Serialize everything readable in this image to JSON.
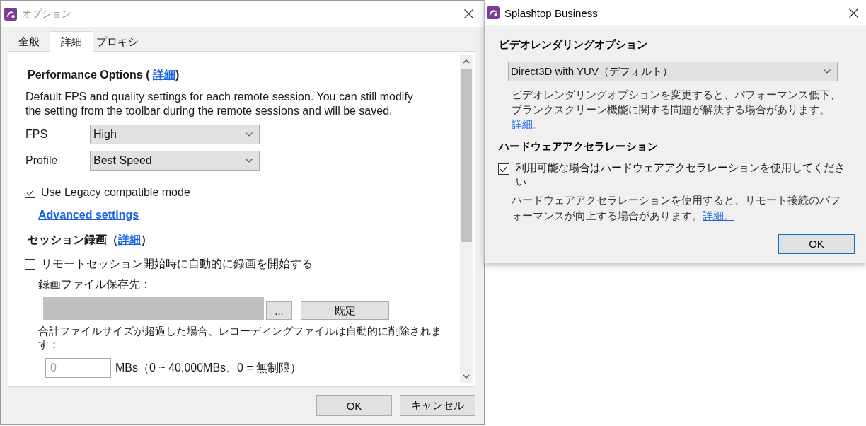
{
  "options_window": {
    "title": "オプション",
    "active": false,
    "tabs": [
      {
        "label": "全般",
        "selected": false
      },
      {
        "label": "詳細",
        "selected": true
      },
      {
        "label": "プロキシ",
        "selected": false
      }
    ],
    "performance": {
      "heading": "Performance Options ( ",
      "heading_link": "詳細",
      "heading_end": ")",
      "description": "Default FPS and quality settings for each remote session. You can still modify the setting from the toolbar during the remote sessions and will be saved.",
      "dropdowns": [
        {
          "label": "FPS",
          "value": "High"
        },
        {
          "label": "Profile",
          "value": "Best Speed"
        }
      ],
      "legacy_mode": {
        "label": "Use Legacy compatible mode",
        "checked": true
      },
      "advanced_link": "Advanced settings"
    },
    "recording": {
      "heading": "セッション録画（",
      "heading_link": "詳細",
      "heading_end": "）",
      "auto_record": {
        "label": "リモートセッション開始時に自動的に録画を開始する",
        "checked": false
      },
      "save_location_label": "録画ファイル保存先：",
      "save_path": {
        "disabled": true
      },
      "browse_button": "...",
      "default_button": "既定",
      "size_limit_text": "合計ファイルサイズが超過した場合、レコーディングファイルは自動的に削除されます：",
      "size_limit": {
        "value": "0",
        "disabled": true
      },
      "size_limit_unit": "MBs（0 ~ 40,000MBs、0 = 無制限）"
    },
    "buttons": [
      {
        "label": "OK",
        "default": false
      },
      {
        "label": "キャンセル",
        "default": false
      }
    ]
  },
  "splashtop_window": {
    "title": "Splashtop Business",
    "active": true,
    "rendering": {
      "heading": "ビデオレンダリングオプション",
      "value": "Direct3D with YUV（デフォルト）",
      "description": "ビデオレンダリングオプションを変更すると、パフォーマンス低下、ブランクスクリーン機能に関する問題が解決する場合があります。",
      "link": "詳細。"
    },
    "acceleration": {
      "heading": "ハードウェアアクセラレーション",
      "checkbox": {
        "label": "利用可能な場合はハードウェアアクセラレーションを使用してください",
        "checked": true
      },
      "description": "ハードウェアアクセラレーションを使用すると、リモート接続のパフォーマンスが向上する場合があります。",
      "link": "詳細。"
    },
    "buttons": [
      {
        "label": "OK",
        "default": true
      }
    ]
  }
}
